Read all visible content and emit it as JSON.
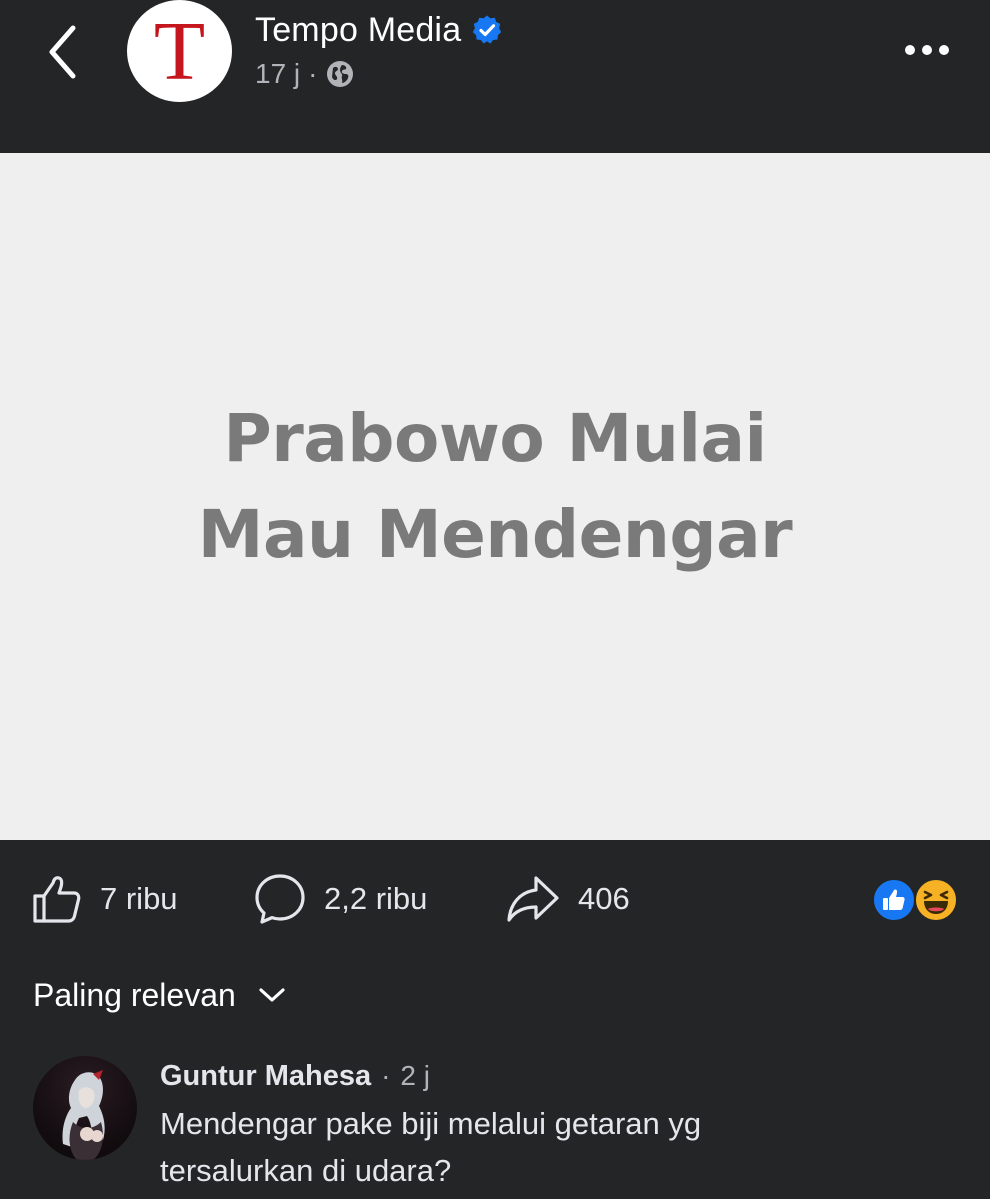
{
  "header": {
    "page_name": "Tempo Media",
    "avatar_letter": "T",
    "time": "17 j",
    "separator": "·",
    "privacy_icon": "globe-icon",
    "verified_icon": "verified-badge-icon",
    "back_icon": "chevron-left-icon",
    "more_icon": "more-horizontal-icon"
  },
  "post": {
    "headline_line1": "Prabowo Mulai",
    "headline_line2": "Mau Mendengar",
    "background_color": "#efefef",
    "text_color": "#7a7a7a"
  },
  "actions": {
    "like_count": "7 ribu",
    "comment_count": "2,2 ribu",
    "share_count": "406",
    "like_icon": "thumbs-up-icon",
    "comment_icon": "comment-bubble-icon",
    "share_icon": "share-arrow-icon",
    "reactions": [
      "like-reaction-icon",
      "haha-reaction-icon"
    ]
  },
  "comments_sort": {
    "label": "Paling relevan",
    "icon": "chevron-down-icon"
  },
  "comments": [
    {
      "author": "Guntur Mahesa",
      "separator": "·",
      "time": "2 j",
      "text_line1": "Mendengar pake biji melalui getaran yg",
      "text_line2": "tersalurkan di udara?"
    }
  ],
  "colors": {
    "background": "#242526",
    "verified_blue": "#1877f2",
    "brand_red": "#c4161c",
    "haha_yellow": "#f7b125"
  }
}
